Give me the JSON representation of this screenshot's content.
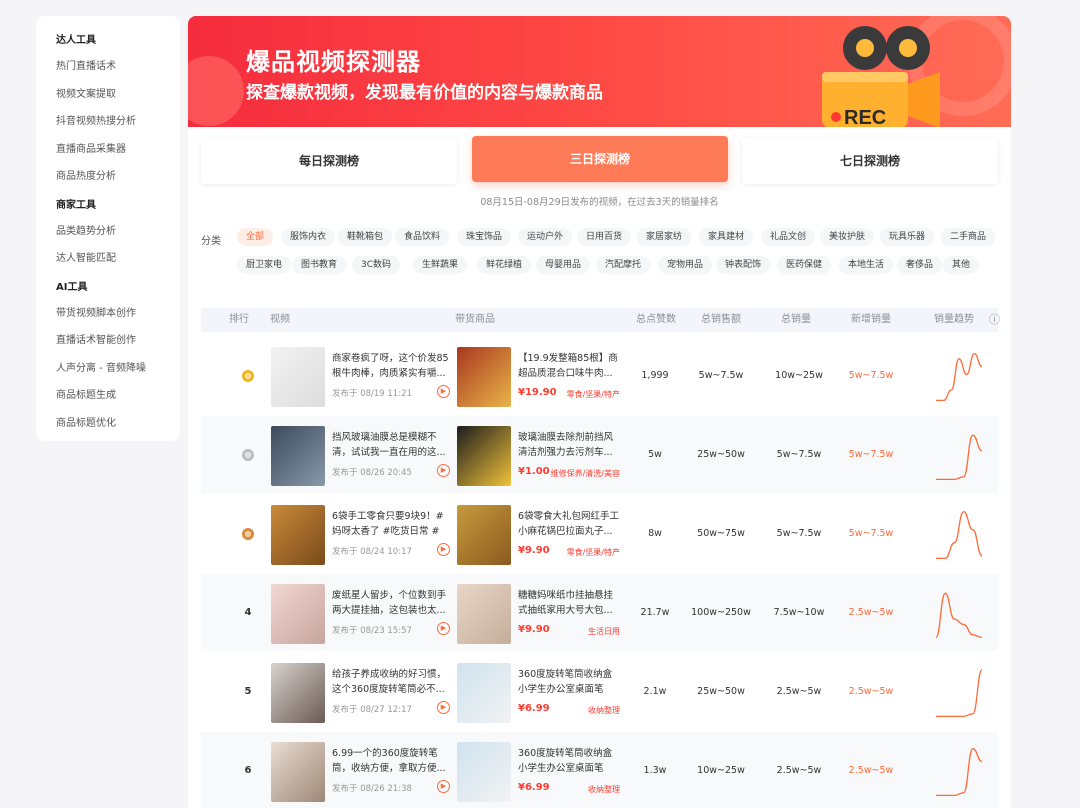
{
  "sidebar": {
    "groups": [
      {
        "title": "达人工具",
        "items": [
          "热门直播话术",
          "视频文案提取",
          "抖音视频热搜分析",
          "直播商品采集器",
          "商品热度分析"
        ]
      },
      {
        "title": "商家工具",
        "items": [
          "品类趋势分析",
          "达人智能匹配"
        ]
      },
      {
        "title": "AI工具",
        "items": [
          "带货视频脚本创作",
          "直播话术智能创作",
          "人声分离 - 音频降噪",
          "商品标题生成",
          "商品标题优化"
        ]
      }
    ]
  },
  "banner": {
    "title": "爆品视频探测器",
    "subtitle": "探查爆款视频，发现最有价值的内容与爆款商品",
    "camera_label": "REC"
  },
  "tabs": [
    {
      "label": "每日探测榜",
      "active": false
    },
    {
      "label": "三日探测榜",
      "active": true
    },
    {
      "label": "七日探测榜",
      "active": false
    }
  ],
  "caption": "08月15日-08月29日发布的视频，在过去3天的销量排名",
  "categories": {
    "label": "分类",
    "row1": [
      "全部",
      "服饰内衣",
      "鞋靴箱包",
      "食品饮料",
      "珠宝饰品",
      "运动户外",
      "日用百货",
      "家居家纺",
      "家具建材",
      "礼品文创",
      "美妆护肤",
      "玩具乐器",
      "二手商品"
    ],
    "row2": [
      "厨卫家电",
      "图书教育",
      "3C数码",
      "生鲜蔬果",
      "鲜花绿植",
      "母婴用品",
      "汽配摩托",
      "宠物用品",
      "钟表配饰",
      "医药保健",
      "本地生活",
      "奢侈品",
      "其他"
    ],
    "active": "全部"
  },
  "table": {
    "headers": [
      "排行",
      "视频",
      "带货商品",
      "总点赞数",
      "总销售额",
      "总销量",
      "新增销量",
      "销量趋势"
    ],
    "rows": [
      {
        "rank": "",
        "medal": "gold",
        "video_title": "商家卷疯了呀，这个价发85根牛肉棒，肉质紧实有嚼...",
        "video_date": "发布于 08/19 11:21",
        "product_title": "【19.9发整箱85根】商超品质混合口味牛肉...",
        "price": "¥19.90",
        "tag": "零食/坚果/特产",
        "likes": "1,999",
        "sales_amount": "5w~7.5w",
        "sales_volume": "10w~25w",
        "new_sales": "5w~7.5w",
        "trend": [
          0.05,
          0.05,
          0.25,
          0.85,
          0.55,
          0.95,
          0.7
        ]
      },
      {
        "rank": "",
        "medal": "silver",
        "video_title": "挡风玻璃油膜总是模糊不清，试试我一直在用的这...",
        "video_date": "发布于 08/26 20:45",
        "product_title": "玻璃油膜去除剂前挡风清洁剂强力去污剂车...",
        "price": "¥1.00",
        "tag": "维修保养/清洗/美容",
        "likes": "5w",
        "sales_amount": "25w~50w",
        "sales_volume": "5w~7.5w",
        "new_sales": "5w~7.5w",
        "trend": [
          0.05,
          0.05,
          0.05,
          0.1,
          0.9,
          0.6
        ]
      },
      {
        "rank": "",
        "medal": "bronze",
        "video_title": "6袋手工零食只要9块9！#妈呀太香了 #吃货日常 #解...",
        "video_date": "发布于 08/24 10:17",
        "product_title": "6袋零食大礼包网红手工小麻花锅巴拉面丸子...",
        "price": "¥9.90",
        "tag": "零食/坚果/特产",
        "likes": "8w",
        "sales_amount": "50w~75w",
        "sales_volume": "5w~7.5w",
        "new_sales": "5w~7.5w",
        "trend": [
          0.05,
          0.05,
          0.35,
          0.95,
          0.6,
          0.1
        ]
      },
      {
        "rank": "4",
        "medal": "",
        "video_title": "废纸星人留步，个位数到手两大提挂抽，这包装也太...",
        "video_date": "发布于 08/23 15:57",
        "product_title": "糖糖妈咪纸巾挂抽悬挂式抽纸家用大号大包...",
        "price": "¥9.90",
        "tag": "生活日用",
        "likes": "21.7w",
        "sales_amount": "100w~250w",
        "sales_volume": "7.5w~10w",
        "new_sales": "2.5w~5w",
        "trend": [
          0.05,
          0.9,
          0.4,
          0.3,
          0.1,
          0.05
        ]
      },
      {
        "rank": "5",
        "medal": "",
        "video_title": "给孩子养成收纳的好习惯，这个360度旋转笔筒必不...",
        "video_date": "发布于 08/27 12:17",
        "product_title": "360度旋转笔筒收纳盒小学生办公室桌面笔筒...",
        "price": "¥6.99",
        "tag": "收纳整理",
        "likes": "2.1w",
        "sales_amount": "25w~50w",
        "sales_volume": "2.5w~5w",
        "new_sales": "2.5w~5w",
        "trend": [
          0.05,
          0.05,
          0.05,
          0.05,
          0.1,
          0.95
        ]
      },
      {
        "rank": "6",
        "medal": "",
        "video_title": "6.99一个的360度旋转笔筒，收纳方便，拿取方便...",
        "video_date": "发布于 08/26 21:38",
        "product_title": "360度旋转笔筒收纳盒小学生办公室桌面笔筒...",
        "price": "¥6.99",
        "tag": "收纳整理",
        "likes": "1.3w",
        "sales_amount": "10w~25w",
        "sales_volume": "2.5w~5w",
        "new_sales": "2.5w~5w",
        "trend": [
          0.05,
          0.05,
          0.05,
          0.1,
          0.95,
          0.7
        ]
      }
    ]
  },
  "colors": {
    "accent": "#ff7a57",
    "red": "#ff3b30",
    "banner_start": "#f52c3e",
    "banner_end": "#ff6c56"
  }
}
